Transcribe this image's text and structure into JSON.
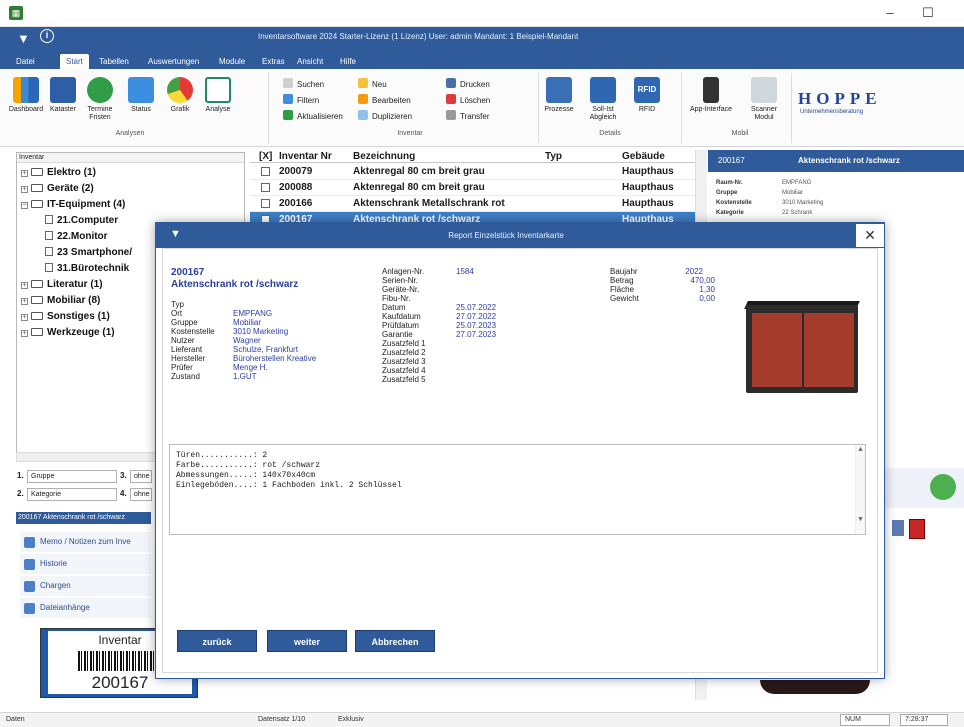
{
  "window": {
    "minimize": "–",
    "maximize": "☐"
  },
  "header": {
    "title": "Inventarsoftware 2024 Starter-Lizenz (1 Lizenz)   User: admin   Mandant: 1 Beispiel-Mandant",
    "tabs": [
      "Datei",
      "Start",
      "Tabellen",
      "Auswertungen",
      "Module",
      "Extras",
      "Ansicht",
      "Hilfe"
    ],
    "active_tab": "Start"
  },
  "ribbon": {
    "analysen": [
      "Dashboard",
      "Kataster",
      "Termine Fristen",
      "Status",
      "Grafik",
      "Analyse"
    ],
    "analysen_label": "Analysen",
    "inventar_small": [
      "Suchen",
      "Filtern",
      "Aktualisieren",
      "Neu",
      "Bearbeiten",
      "Duplizieren",
      "Drucken",
      "Löschen",
      "Transfer"
    ],
    "inventar_label": "Inventar",
    "details_buttons": [
      "Prozesse",
      "Soll-Ist Abgleich",
      "RFID"
    ],
    "details_label": "Details",
    "mobil_buttons": [
      "App-Interface",
      "Scanner Modul"
    ],
    "mobil_label": "Mobil",
    "rfid_badge": "RFID",
    "hoppe_logo": "HOPPE",
    "hoppe_sub": "Unternehmensberatung"
  },
  "tree": {
    "header": "Inventar",
    "items": [
      {
        "label": "Elektro (1)",
        "level": 0
      },
      {
        "label": "Geräte (2)",
        "level": 0
      },
      {
        "label": "IT-Equipment (4)",
        "level": 0
      },
      {
        "label": "21.Computer",
        "level": 1
      },
      {
        "label": "22.Monitor",
        "level": 1
      },
      {
        "label": "23 Smartphone/",
        "level": 1
      },
      {
        "label": "31.Bürotechnik",
        "level": 1
      },
      {
        "label": "Literatur (1)",
        "level": 0
      },
      {
        "label": "Mobiliar (8)",
        "level": 0
      },
      {
        "label": "Sonstiges (1)",
        "level": 0
      },
      {
        "label": "Werkzeuge (1)",
        "level": 0
      }
    ]
  },
  "filters": {
    "row1": {
      "num": "1.",
      "value": "Gruppe",
      "num2": "3.",
      "value2": "ohne"
    },
    "row2": {
      "num": "2.",
      "value": "Kategorie",
      "num2": "4.",
      "value2": "ohne"
    }
  },
  "left_panel": {
    "title": "200167 Aktenschrank rot /schwarz",
    "items": [
      "Memo / Notizen zum Inve",
      "Historie",
      "Chargen",
      "Dateianhänge"
    ]
  },
  "barcode": {
    "label": "Inventar",
    "number": "200167"
  },
  "grid": {
    "headers": [
      "[X]",
      "Inventar Nr",
      "Bezeichnung",
      "Typ",
      "Gebäude"
    ],
    "rows": [
      {
        "nr": "200079",
        "bez": "Aktenregal 80 cm breit grau",
        "typ": "",
        "geb": "Haupthaus",
        "selected": false
      },
      {
        "nr": "200088",
        "bez": "Aktenregal 80 cm breit grau",
        "typ": "",
        "geb": "Haupthaus",
        "selected": false
      },
      {
        "nr": "200166",
        "bez": "Aktenschrank Metallschrank rot",
        "typ": "",
        "geb": "Haupthaus",
        "selected": false
      },
      {
        "nr": "200167",
        "bez": "Aktenschrank rot /schwarz",
        "typ": "",
        "geb": "Haupthaus",
        "selected": true
      }
    ]
  },
  "detail": {
    "nr": "200167",
    "name": "Aktenschrank rot /schwarz",
    "rows": [
      {
        "k": "Raum-Nr.",
        "v": "EMPFANG"
      },
      {
        "k": "Gruppe",
        "v": "Mobiliar"
      },
      {
        "k": "Kostenstelle",
        "v": "3010 Marketing"
      },
      {
        "k": "Kategorie",
        "v": "22 Schrank"
      }
    ]
  },
  "modal": {
    "title": "Report Einzelstück Inventarkarte",
    "menu_icon": "▼",
    "close": "✕",
    "item_nr": "200167",
    "item_name": "Aktenschrank  rot /schwarz",
    "left_fields": [
      {
        "k": "Typ",
        "v": ""
      },
      {
        "k": "Ort",
        "v": "EMPFANG"
      },
      {
        "k": "Gruppe",
        "v": "Mobiliar"
      },
      {
        "k": "Kostenstelle",
        "v": "3010 Marketing"
      },
      {
        "k": "Nutzer",
        "v": "Wagner"
      },
      {
        "k": "Lieferant",
        "v": "Schulze, Frankfurt"
      },
      {
        "k": "Hersteller",
        "v": "Büroherstellen Kreative"
      },
      {
        "k": "Prüfer",
        "v": "Menge H."
      },
      {
        "k": "Zustand",
        "v": "1.GUT"
      }
    ],
    "mid_fields": [
      {
        "k": "Anlagen-Nr.",
        "v": "1584"
      },
      {
        "k": "Serien-Nr.",
        "v": ""
      },
      {
        "k": "Geräte-Nr.",
        "v": ""
      },
      {
        "k": "Fibu-Nr.",
        "v": ""
      },
      {
        "k": "Datum",
        "v": "25.07.2022"
      },
      {
        "k": "Kaufdatum",
        "v": "27.07.2022"
      },
      {
        "k": "Prüfdatum",
        "v": "25.07.2023"
      },
      {
        "k": "Garantie",
        "v": "27.07.2023"
      },
      {
        "k": "Zusatzfeld 1",
        "v": ""
      },
      {
        "k": "Zusatzfeld 2",
        "v": ""
      },
      {
        "k": "Zusatzfeld 3",
        "v": ""
      },
      {
        "k": "Zusatzfeld 4",
        "v": ""
      },
      {
        "k": "Zusatzfeld 5",
        "v": ""
      }
    ],
    "right_fields": [
      {
        "k": "Baujahr",
        "v": "2022"
      },
      {
        "k": "Betrag",
        "v": "470,00"
      },
      {
        "k": "Fläche",
        "v": "1,30"
      },
      {
        "k": "Gewicht",
        "v": "0,00"
      }
    ],
    "memo_lines": [
      "Türen...........: 2",
      "Farbe...........: rot /schwarz",
      "Abmessungen.....: 140x70x40cm",
      "Einlegeböden....: 1 Fachboden inkl. 2 Schlüssel"
    ],
    "buttons": [
      "zurück",
      "weiter",
      "Abbrechen"
    ]
  },
  "status": {
    "left": "Daten",
    "datensatz": "Datensatz 1/10",
    "mode": "Exklusiv",
    "num": "NUM",
    "time": "7:28:37"
  }
}
